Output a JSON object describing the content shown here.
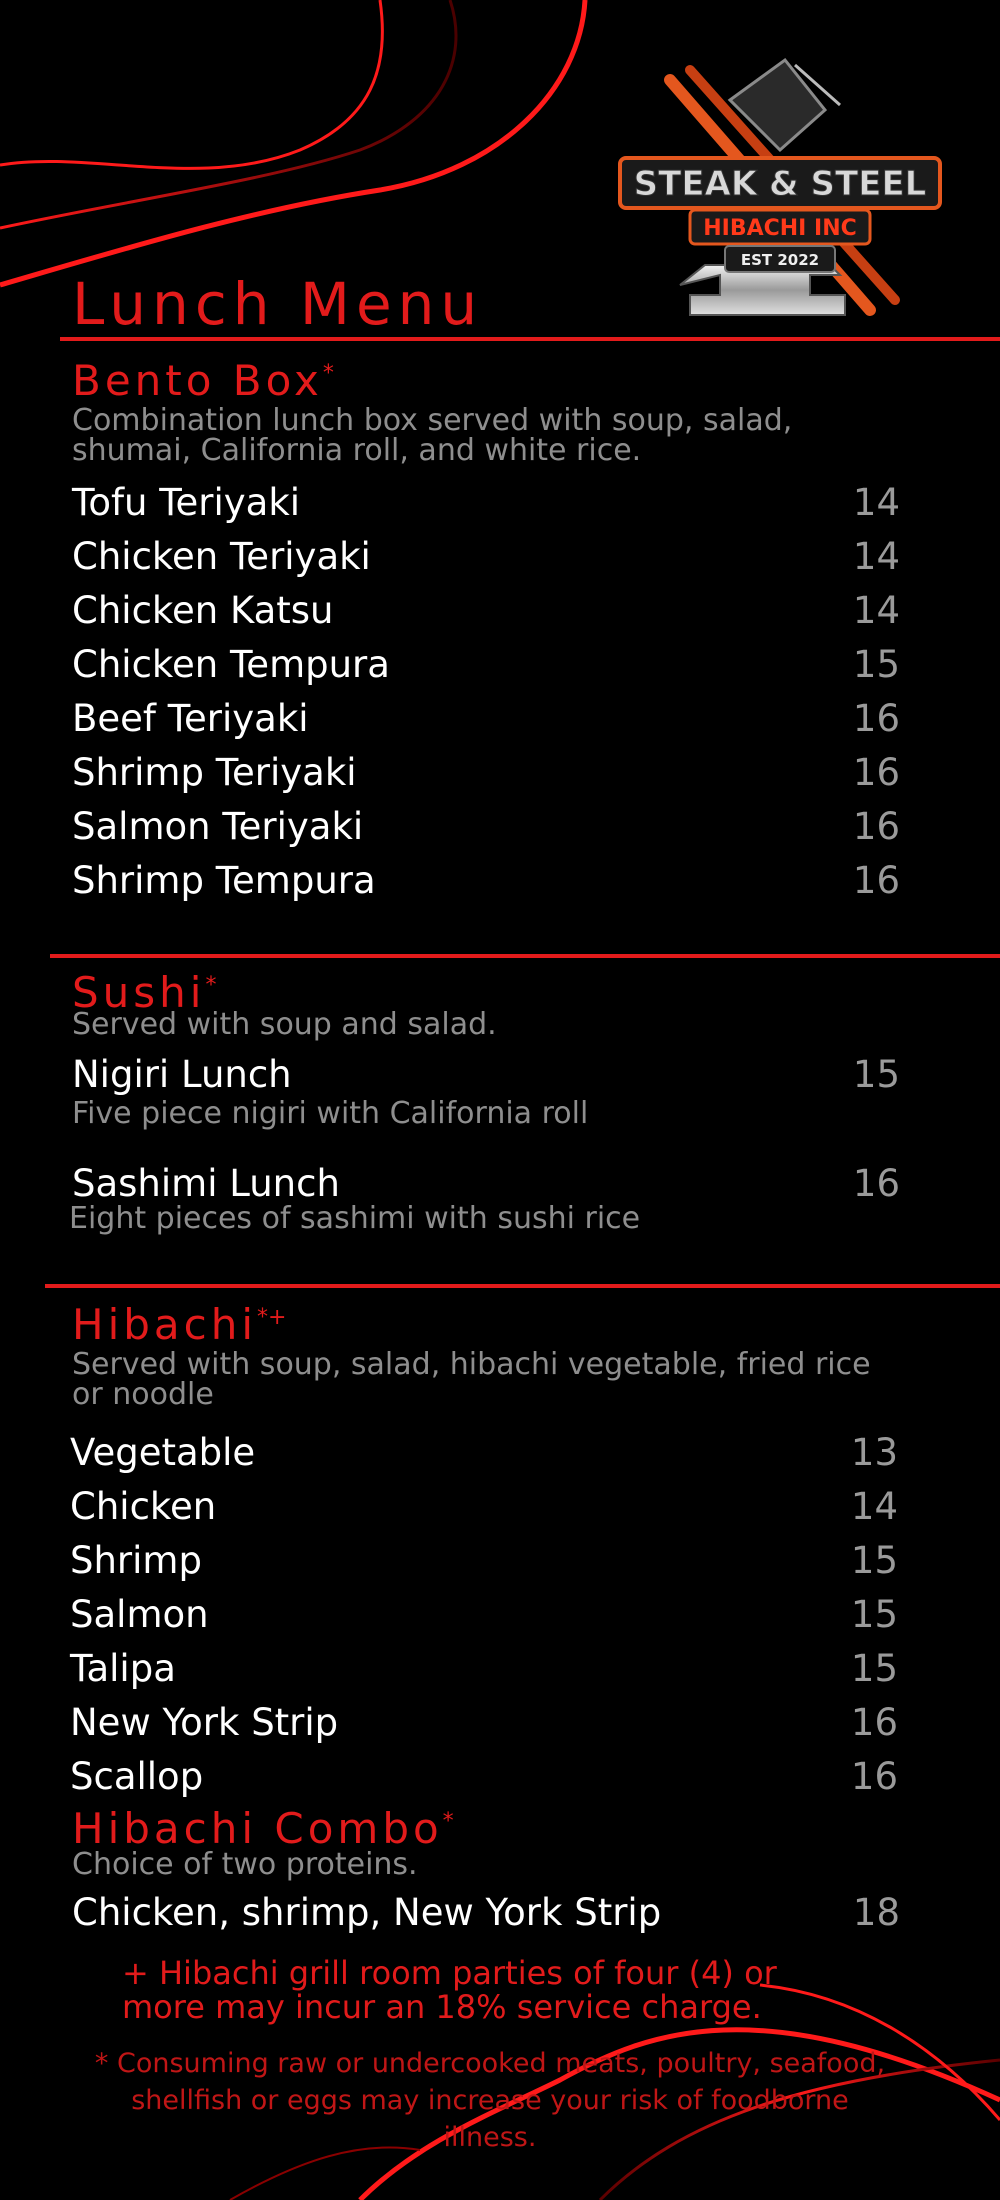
{
  "logo": {
    "line1": "STEAK & STEEL",
    "line2": "HIBACHI INC",
    "line3": "EST 2022"
  },
  "page_title": "Lunch Menu",
  "bento": {
    "title": "Bento Box",
    "mark": "*",
    "desc_line1": "Combination lunch box served with soup, salad,",
    "desc_line2": "shumai, California roll, and white rice.",
    "items": [
      {
        "name": "Tofu Teriyaki",
        "price": "14"
      },
      {
        "name": "Chicken Teriyaki",
        "price": "14"
      },
      {
        "name": "Chicken Katsu",
        "price": "14"
      },
      {
        "name": "Chicken Tempura",
        "price": "15"
      },
      {
        "name": "Beef Teriyaki",
        "price": "16"
      },
      {
        "name": "Shrimp Teriyaki",
        "price": "16"
      },
      {
        "name": "Salmon Teriyaki",
        "price": "16"
      },
      {
        "name": "Shrimp Tempura",
        "price": "16"
      }
    ]
  },
  "sushi": {
    "title": "Sushi",
    "mark": "*",
    "desc": "Served with soup and salad.",
    "items": [
      {
        "name": "Nigiri Lunch",
        "price": "15",
        "desc": "Five piece nigiri with California roll"
      },
      {
        "name": "Sashimi Lunch",
        "price": "16",
        "desc": "Eight pieces of sashimi with sushi rice"
      }
    ]
  },
  "hibachi": {
    "title": "Hibachi",
    "mark": "*+",
    "desc_line1": "Served with soup, salad, hibachi vegetable, fried rice",
    "desc_line2": "or noodle",
    "items": [
      {
        "name": "Vegetable",
        "price": "13"
      },
      {
        "name": "Chicken",
        "price": "14"
      },
      {
        "name": "Shrimp",
        "price": "15"
      },
      {
        "name": "Salmon",
        "price": "15"
      },
      {
        "name": "Talipa",
        "price": "15"
      },
      {
        "name": "New York Strip",
        "price": "16"
      },
      {
        "name": "Scallop",
        "price": "16"
      }
    ]
  },
  "combo": {
    "title": "Hibachi Combo",
    "mark": "*",
    "desc": "Choice of two proteins.",
    "item": {
      "name": "Chicken, shrimp, New York Strip",
      "price": "18"
    }
  },
  "notes": {
    "plus_line1": "+ Hibachi grill room parties of four (4) or",
    "plus_line2": "more may incur an 18% service charge.",
    "star_line1": "* Consuming raw or undercooked meats, poultry, seafood,",
    "star_line2": "shellfish or eggs may increase your risk of foodborne",
    "star_line3": "illness."
  },
  "colors": {
    "accent": "#e21b1b",
    "muted_text": "#8e8e8e",
    "price_text": "#9a9a9a",
    "background": "#000000"
  }
}
